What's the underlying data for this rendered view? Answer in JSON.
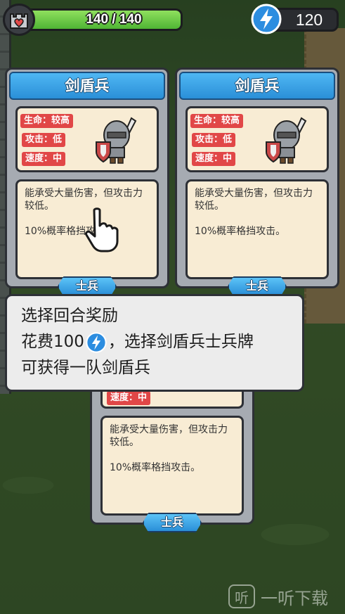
{
  "hud": {
    "hp_text": "140 / 140",
    "hp_fraction": 1.0,
    "energy": "120",
    "colors": {
      "hp": "#5fc63e",
      "energy": "#2c8de0"
    }
  },
  "cards": [
    {
      "title": "剑盾兵",
      "stats": [
        "生命：较高",
        "攻击：低",
        "速度：中"
      ],
      "desc_1": "能承受大量伤害，但攻击力较低。",
      "desc_2": "10%概率格挡攻击。",
      "tag": "士兵"
    },
    {
      "title": "剑盾兵",
      "stats": [
        "生命：较高",
        "攻击：低",
        "速度：中"
      ],
      "desc_1": "能承受大量伤害，但攻击力较低。",
      "desc_2": "10%概率格挡攻击。",
      "tag": "士兵"
    },
    {
      "stats": [
        "速度：中"
      ],
      "desc_1": "能承受大量伤害，但攻击力较低。",
      "desc_2": "10%概率格挡攻击。",
      "tag": "士兵"
    }
  ],
  "tooltip": {
    "line1": "选择回合奖励",
    "line2_pre": "花费100",
    "line2_post": "，选择剑盾兵士兵牌",
    "line3": "可获得一队剑盾兵"
  },
  "watermark": {
    "logo": "听",
    "text": "一听下载"
  },
  "icons": {
    "castle": "castle-heart-icon",
    "energy": "lightning-bolt-icon",
    "pointer": "pointing-hand-icon",
    "unit": "sword-shield-knight-icon"
  }
}
